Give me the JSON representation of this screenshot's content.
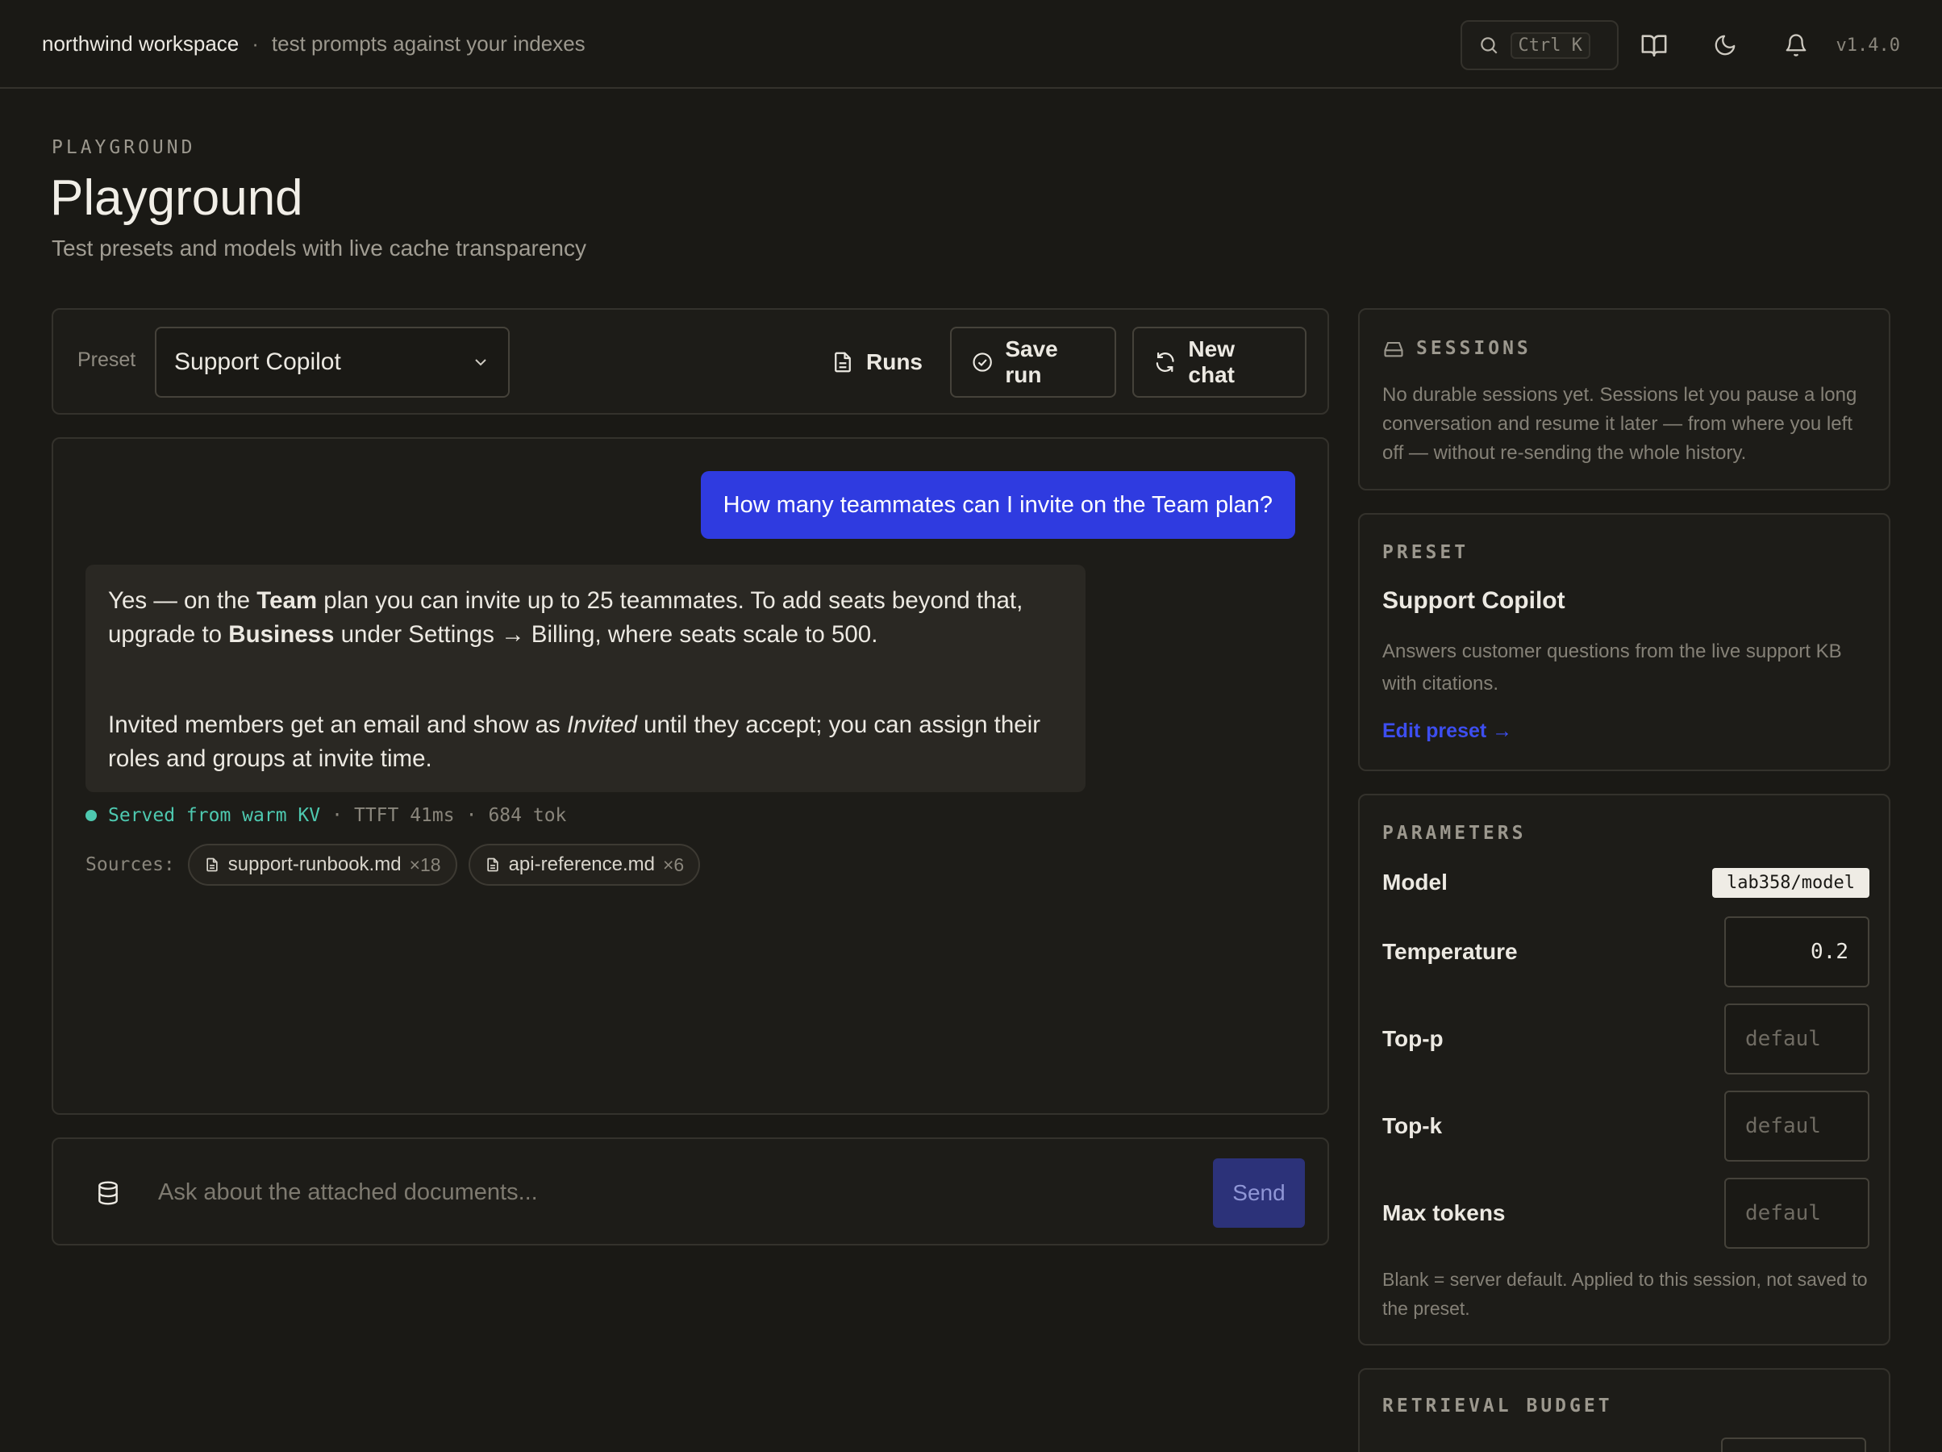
{
  "topbar": {
    "workspace": "northwind workspace",
    "separator": "·",
    "tagline": "test prompts against your indexes",
    "search_shortcut": "Ctrl K",
    "version": "v1.4.0"
  },
  "header": {
    "eyebrow": "PLAYGROUND",
    "title": "Playground",
    "subtitle": "Test presets and models with live cache transparency"
  },
  "toolbar": {
    "preset_label": "Preset",
    "preset_value": "Support Copilot",
    "runs_label": "Runs",
    "save_run_label": "Save run",
    "new_chat_label": "New chat"
  },
  "chat": {
    "user_message": "How many teammates can I invite on the Team plan?",
    "assistant": {
      "p1_a": "Yes — on the ",
      "p1_b": "Team",
      "p1_c": " plan you can invite up to 25 teammates. To add seats beyond that, upgrade to ",
      "p1_d": "Business",
      "p1_e": " under Settings → Billing, where seats scale to 500.",
      "p2_a": "Invited members get an email and show as ",
      "p2_b": "Invited",
      "p2_c": " until they accept; you can assign their roles and groups at invite time."
    },
    "meta": {
      "served": "Served from warm KV",
      "sep": "·",
      "ttft": "TTFT 41ms",
      "tokens": "684 tok"
    },
    "sources_label": "Sources:",
    "sources": [
      {
        "name": "support-runbook.md",
        "count": "×18"
      },
      {
        "name": "api-reference.md",
        "count": "×6"
      }
    ]
  },
  "composer": {
    "placeholder": "Ask about the attached documents...",
    "send_label": "Send"
  },
  "sessions": {
    "heading": "SESSIONS",
    "text": "No durable sessions yet. Sessions let you pause a long conversation and resume it later — from where you left off — without re-sending the whole history."
  },
  "preset_card": {
    "heading": "PRESET",
    "name": "Support Copilot",
    "description": "Answers customer questions from the live support KB with citations.",
    "edit_link": "Edit preset →"
  },
  "parameters": {
    "heading": "PARAMETERS",
    "model_label": "Model",
    "model_value": "lab358/model",
    "temperature_label": "Temperature",
    "temperature_value": "0.2",
    "top_p_label": "Top-p",
    "top_p_placeholder": "defaul",
    "top_k_label": "Top-k",
    "top_k_placeholder": "defaul",
    "max_tokens_label": "Max tokens",
    "max_tokens_placeholder": "defaul",
    "note": "Blank = server default. Applied to this session, not saved to the preset."
  },
  "retrieval": {
    "heading": "RETRIEVAL BUDGET"
  },
  "colors": {
    "accent": "#2f3be0",
    "success": "#4ec9b0",
    "background": "#1a1915"
  }
}
